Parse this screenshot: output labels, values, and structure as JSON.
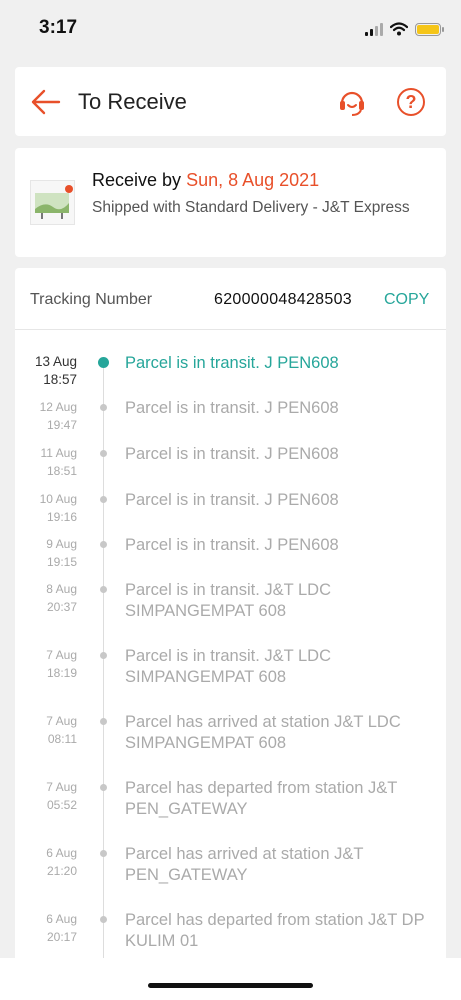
{
  "status_bar": {
    "time": "3:17",
    "icons": [
      "signal-icon",
      "wifi-icon",
      "battery-icon"
    ]
  },
  "header": {
    "title": "To Receive",
    "back_icon": "back-arrow-icon",
    "support_icon": "customer-support-icon",
    "help_symbol": "?"
  },
  "delivery": {
    "receive_label": "Receive by",
    "receive_date": "Sun, 8 Aug 2021",
    "shipped_text": "Shipped with Standard Delivery  - J&T Express"
  },
  "tracking": {
    "label": "Tracking Number",
    "number": "620000048428503",
    "copy_label": "COPY",
    "events": [
      {
        "date": "13 Aug",
        "time": "18:57",
        "text": "Parcel is in transit. J PEN608"
      },
      {
        "date": "12 Aug",
        "time": "19:47",
        "text": "Parcel is in transit. J PEN608"
      },
      {
        "date": "11 Aug",
        "time": "18:51",
        "text": "Parcel is in transit. J PEN608"
      },
      {
        "date": "10 Aug",
        "time": "19:16",
        "text": "Parcel is in transit. J PEN608"
      },
      {
        "date": "9 Aug",
        "time": "19:15",
        "text": "Parcel is in transit. J PEN608"
      },
      {
        "date": "8 Aug",
        "time": "20:37",
        "text": "Parcel is in transit. J&T LDC SIMPANGEMPAT 608"
      },
      {
        "date": "7 Aug",
        "time": "18:19",
        "text": "Parcel is in transit. J&T LDC SIMPANGEMPAT 608"
      },
      {
        "date": "7 Aug",
        "time": "08:11",
        "text": "Parcel has arrived at station J&T LDC SIMPANGEMPAT 608"
      },
      {
        "date": "7 Aug",
        "time": "05:52",
        "text": "Parcel has departed from station J&T PEN_GATEWAY"
      },
      {
        "date": "6 Aug",
        "time": "21:20",
        "text": "Parcel has arrived at station J&T PEN_GATEWAY"
      },
      {
        "date": "6 Aug",
        "time": "20:17",
        "text": "Parcel has departed from station J&T DP KULIM 01"
      }
    ]
  },
  "colors": {
    "accent": "#e8502a",
    "teal": "#26a69a",
    "muted": "#aaaaaa"
  }
}
